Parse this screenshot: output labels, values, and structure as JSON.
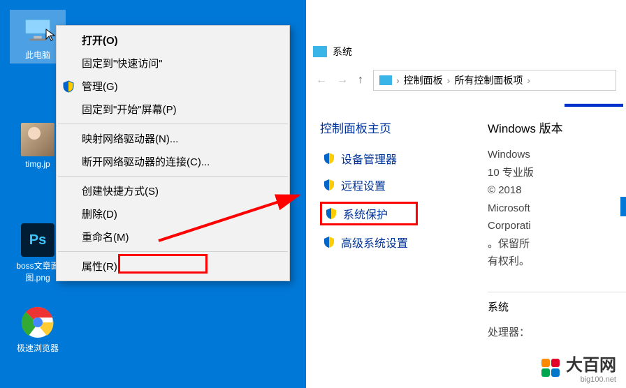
{
  "desktop": {
    "icons": {
      "thispc_label": "此电脑",
      "timg_label": "timg.jp",
      "bossdoc_label": "boss文章面图.png",
      "browser_label": "极速浏览器",
      "ps_glyph": "Ps"
    }
  },
  "context_menu": {
    "open": "打开(O)",
    "pin_quick": "固定到\"快速访问\"",
    "manage": "管理(G)",
    "pin_start": "固定到\"开始\"屏幕(P)",
    "map_drive": "映射网络驱动器(N)...",
    "disconnect_drive": "断开网络驱动器的连接(C)...",
    "create_shortcut": "创建快捷方式(S)",
    "delete": "删除(D)",
    "rename": "重命名(M)",
    "properties": "属性(R)"
  },
  "system_window": {
    "title": "系统",
    "breadcrumb": [
      "控制面板",
      "所有控制面板项"
    ],
    "panel_home": "控制面板主页",
    "tasks": {
      "device_manager": "设备管理器",
      "remote_settings": "远程设置",
      "system_protection": "系统保护",
      "advanced_settings": "高级系统设置"
    },
    "windows_edition_title": "Windows 版本",
    "edition_line1": "Windows",
    "edition_line2": "10 专业版",
    "copyright_line1": "© 2018",
    "copyright_line2": "Microsoft",
    "copyright_line3": "Corporati",
    "copyright_line4": "。保留所",
    "copyright_line5": "有权利。",
    "system_section": "系统",
    "processor_label": "处理器："
  },
  "brand": {
    "name": "大百网",
    "url": "big100.net"
  }
}
